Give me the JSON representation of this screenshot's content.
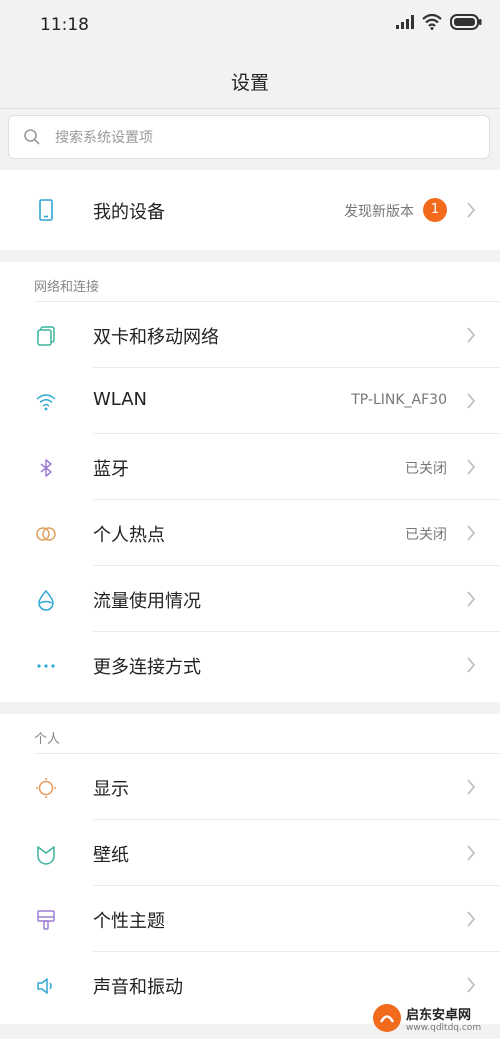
{
  "status_bar": {
    "time": "11:18"
  },
  "header": {
    "title": "设置"
  },
  "search": {
    "placeholder": "搜索系统设置项"
  },
  "device": {
    "label": "我的设备",
    "value": "发现新版本",
    "badge": "1"
  },
  "network": {
    "section_title": "网络和连接",
    "items": [
      {
        "label": "双卡和移动网络",
        "value": "",
        "icon": "sim-card-icon"
      },
      {
        "label": "WLAN",
        "value": "TP-LINK_AF30",
        "icon": "wifi-icon"
      },
      {
        "label": "蓝牙",
        "value": "已关闭",
        "icon": "bluetooth-icon"
      },
      {
        "label": "个人热点",
        "value": "已关闭",
        "icon": "hotspot-icon"
      },
      {
        "label": "流量使用情况",
        "value": "",
        "icon": "data-usage-icon"
      },
      {
        "label": "更多连接方式",
        "value": "",
        "icon": "more-icon"
      }
    ]
  },
  "personal": {
    "section_title": "个人",
    "items": [
      {
        "label": "显示",
        "icon": "display-icon"
      },
      {
        "label": "壁纸",
        "icon": "wallpaper-icon"
      },
      {
        "label": "个性主题",
        "icon": "theme-icon"
      },
      {
        "label": "声音和振动",
        "icon": "sound-icon"
      }
    ]
  },
  "watermark": {
    "title": "启东安卓网",
    "url": "www.qdltdq.com"
  },
  "colors": {
    "accent_orange": "#f26b1d",
    "icon_blue": "#2fa7d4"
  }
}
